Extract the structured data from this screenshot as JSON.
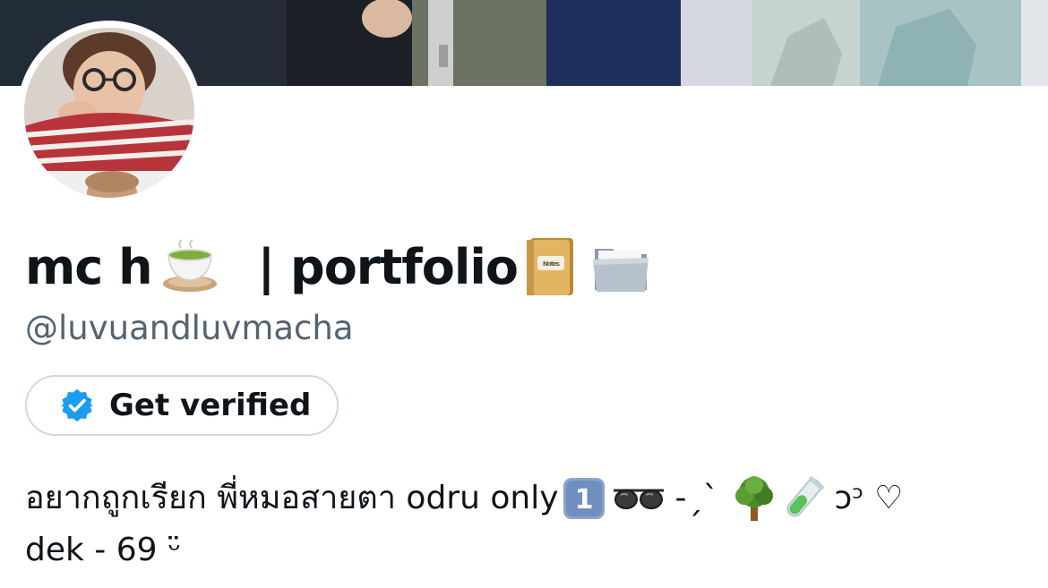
{
  "profile": {
    "display_name_part1": "mc h",
    "display_name_part2": "| portfolio",
    "handle": "@luvuandluvmacha",
    "name_emojis": [
      "teacup-icon",
      "notebook-icon",
      "folder-icon"
    ],
    "notebook_label": "Notes"
  },
  "verify_button": {
    "label": "Get verified",
    "icon": "verified-badge-icon",
    "badge_color": "#1d9bf0"
  },
  "bio": {
    "line1_text": "อยากถูกเรียก พี่หมอสายตา odru only",
    "keycap_digit": "1",
    "line1_symbols_a": "-ˏˋ",
    "line1_symbols_b": "ɔ",
    "line1_symbols_c": "ᵓ ♡",
    "line2_text": "dek - 69",
    "line2_face": "ᵕ̈",
    "icons": [
      "keycap-1-icon",
      "glasses-icon",
      "tree-icon",
      "test-tube-icon"
    ]
  },
  "colors": {
    "text_primary": "#0f1419",
    "text_secondary": "#536471",
    "border": "#cfd9de"
  }
}
